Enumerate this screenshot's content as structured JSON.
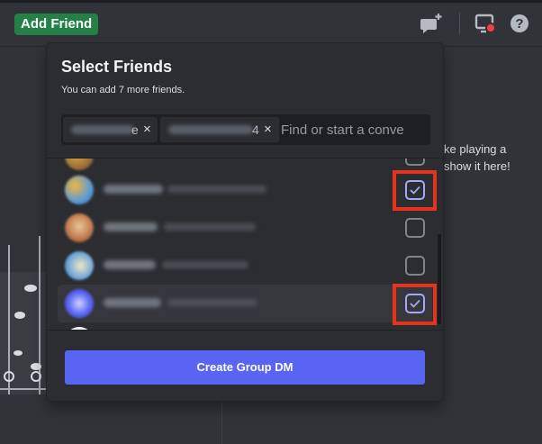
{
  "topbar": {
    "add_friend_label": "Add Friend",
    "icons": [
      "new-group-dm-icon",
      "inbox-icon",
      "help-icon"
    ]
  },
  "background": {
    "activity_line1": "ke playing a",
    "activity_line2": "show it here!"
  },
  "popup": {
    "title": "Select Friends",
    "subtitle": "You can add 7 more friends.",
    "chips": [
      {
        "visible_suffix": "e",
        "remove": "×"
      },
      {
        "visible_suffix": "4",
        "remove": "×"
      }
    ],
    "search_placeholder": "Find or start a conve",
    "friends": [
      {
        "avatar_colors": [
          "#f0b640",
          "#5b9bd5"
        ],
        "selected": true,
        "highlighted": false
      },
      {
        "avatar_colors": [
          "#c47e52",
          "#e9c59a"
        ],
        "selected": false,
        "highlighted": false
      },
      {
        "avatar_colors": [
          "#6fa7d8",
          "#f2e5c4"
        ],
        "selected": false,
        "highlighted": false
      },
      {
        "avatar_colors": [
          "#5865f2",
          "#cfd2ff"
        ],
        "selected": true,
        "highlighted": true
      }
    ],
    "create_button_label": "Create Group DM"
  },
  "colors": {
    "accent": "#5865f2",
    "green": "#248046",
    "highlight_box": "#e8321b",
    "checked": "#a4a9f7"
  }
}
